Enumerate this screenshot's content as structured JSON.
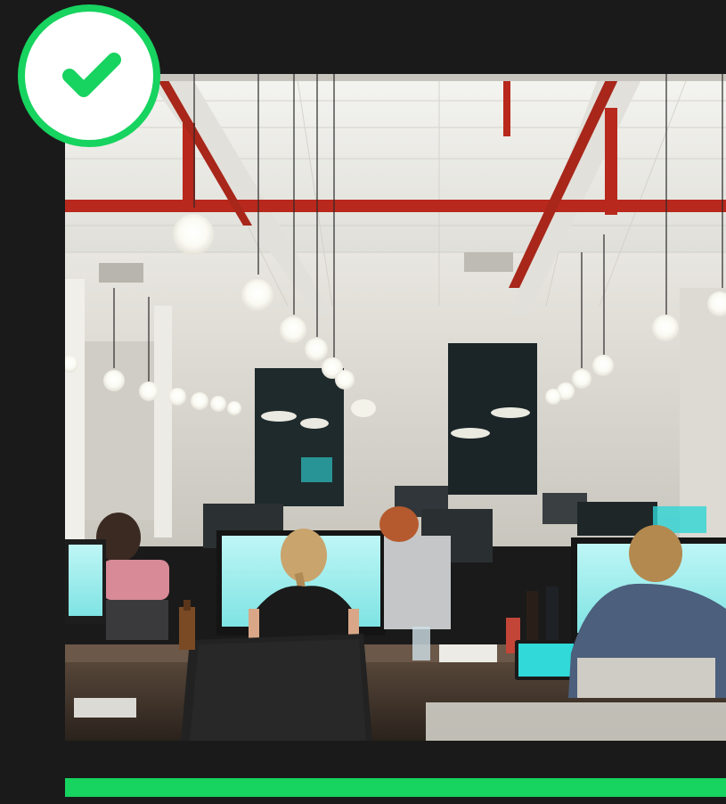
{
  "photo": {
    "subject": "office-workspace-photo"
  },
  "badge": {
    "icon": "checkmark-icon",
    "color": "#17d35f"
  },
  "colors": {
    "background": "#1a1a1a",
    "accent": "#17d35f",
    "pipes": "#b8281c"
  }
}
